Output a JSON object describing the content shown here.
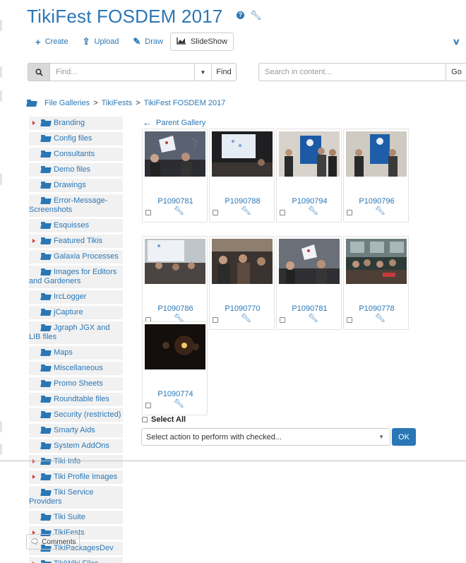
{
  "page": {
    "title": "TikiFest FOSDEM 2017",
    "title_help_icon": "question-icon",
    "title_edit_icon": "wrench-icon"
  },
  "toolbar": {
    "create": "Create",
    "upload": "Upload",
    "draw": "Draw",
    "slideshow": "SlideShow"
  },
  "search": {
    "placeholder": "Find...",
    "find_label": "Find",
    "content_placeholder": "Search in content...",
    "go_label": "Go"
  },
  "breadcrumb": [
    "File Galleries",
    "TikiFests",
    "TikiFest FOSDEM 2017"
  ],
  "sidebar": {
    "items": [
      {
        "label": "Branding",
        "expandable": true
      },
      {
        "label": "Config files",
        "expandable": false
      },
      {
        "label": "Consultants",
        "expandable": false
      },
      {
        "label": "Demo files",
        "expandable": false
      },
      {
        "label": "Drawings",
        "expandable": false
      },
      {
        "label": "Error-Message-Screenshots",
        "expandable": false
      },
      {
        "label": "Esquisses",
        "expandable": false
      },
      {
        "label": "Featured Tikis",
        "expandable": true
      },
      {
        "label": "Galaxia Processes",
        "expandable": false
      },
      {
        "label": "Images for Editors and Gardeners",
        "expandable": false
      },
      {
        "label": "IrcLogger",
        "expandable": false
      },
      {
        "label": "jCapture",
        "expandable": false
      },
      {
        "label": "Jgraph JGX and LIB files",
        "expandable": false
      },
      {
        "label": "Maps",
        "expandable": false
      },
      {
        "label": "Miscellaneous",
        "expandable": false
      },
      {
        "label": "Promo Sheets",
        "expandable": false
      },
      {
        "label": "Roundtable files",
        "expandable": false
      },
      {
        "label": "Security (restricted)",
        "expandable": false
      },
      {
        "label": "Smarty Aids",
        "expandable": false
      },
      {
        "label": "System AddOns",
        "expandable": false
      },
      {
        "label": "Tiki Info",
        "expandable": true
      },
      {
        "label": "Tiki Profile Images",
        "expandable": true
      },
      {
        "label": "Tiki Service Providers",
        "expandable": false
      },
      {
        "label": "Tiki Suite",
        "expandable": false
      },
      {
        "label": "TikiFests",
        "expandable": true
      },
      {
        "label": "TikiPackagesDev",
        "expandable": false
      },
      {
        "label": "TikiWiki Files",
        "expandable": true
      }
    ]
  },
  "gallery": {
    "parent_label": "Parent Gallery",
    "files": [
      {
        "name": "P1090781"
      },
      {
        "name": "P1090788"
      },
      {
        "name": "P1090794"
      },
      {
        "name": "P1090796"
      },
      {
        "name": "P1090786"
      },
      {
        "name": "P1090770"
      },
      {
        "name": "P1090781"
      },
      {
        "name": "P1090778"
      },
      {
        "name": "P1090774"
      }
    ]
  },
  "actions": {
    "select_all_label": "Select All",
    "action_placeholder": "Select action to perform with checked...",
    "ok_label": "OK"
  },
  "comments_label": "Comments",
  "colors": {
    "accent": "#2a77b6",
    "tree_bg": "#f1f1f1",
    "expand_arrow": "#d9352e"
  }
}
